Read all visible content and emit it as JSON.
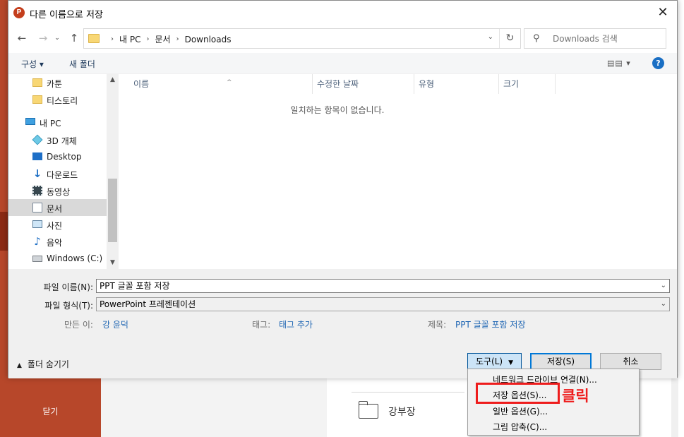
{
  "background": {
    "close_label": "닫기",
    "folder_item_label": "강부장",
    "accent_color": "#b7472a"
  },
  "dialog": {
    "title": "다른 이름으로 저장",
    "app_icon_letter": "P",
    "close_glyph": "✕"
  },
  "navigation": {
    "back_glyph": "←",
    "forward_glyph": "→",
    "recent_glyph": "⌄",
    "up_glyph": "↑",
    "breadcrumbs": [
      "내 PC",
      "문서",
      "Downloads"
    ],
    "refresh_glyph": "↻",
    "search_placeholder": "Downloads 검색"
  },
  "toolbar": {
    "organize_label": "구성 ▾",
    "new_folder_label": "새 폴더",
    "view_glyph": "▤▤ ▾",
    "help_glyph": "?"
  },
  "sidebar": {
    "items": [
      {
        "label": "카툰",
        "icon": "folder-icon"
      },
      {
        "label": "티스토리",
        "icon": "folder-icon"
      },
      {
        "label": "내 PC",
        "icon": "computer-icon"
      },
      {
        "label": "3D 개체",
        "icon": "cube-icon"
      },
      {
        "label": "Desktop",
        "icon": "desktop-icon"
      },
      {
        "label": "다운로드",
        "icon": "download-icon"
      },
      {
        "label": "동영상",
        "icon": "video-icon"
      },
      {
        "label": "문서",
        "icon": "document-icon",
        "selected": true
      },
      {
        "label": "사진",
        "icon": "picture-icon"
      },
      {
        "label": "음악",
        "icon": "music-icon"
      },
      {
        "label": "Windows (C:)",
        "icon": "drive-icon"
      }
    ]
  },
  "file_list": {
    "columns": [
      "이름",
      "수정한 날짜",
      "유형",
      "크기"
    ],
    "empty_message": "일치하는 항목이 없습니다."
  },
  "form": {
    "filename_label": "파일 이름(N):",
    "filename_value": "PPT 글꼴 포함 저장",
    "filetype_label": "파일 형식(T):",
    "filetype_value": "PowerPoint 프레젠테이션",
    "author_label": "만든 이:",
    "author_value": "강 윤덕",
    "tags_label": "태그:",
    "tags_value": "태그 추가",
    "title_label": "제목:",
    "title_value": "PPT 글꼴 포함 저장"
  },
  "footer": {
    "hide_folders_label": "폴더 숨기기",
    "tools_label": "도구(L)",
    "save_label": "저장(S)",
    "cancel_label": "취소"
  },
  "tools_menu": {
    "items": [
      "네트워크 드라이브 연결(N)...",
      "저장 옵션(S)...",
      "일반 옵션(G)...",
      "그림 압축(C)..."
    ],
    "annotation": "클릭"
  }
}
